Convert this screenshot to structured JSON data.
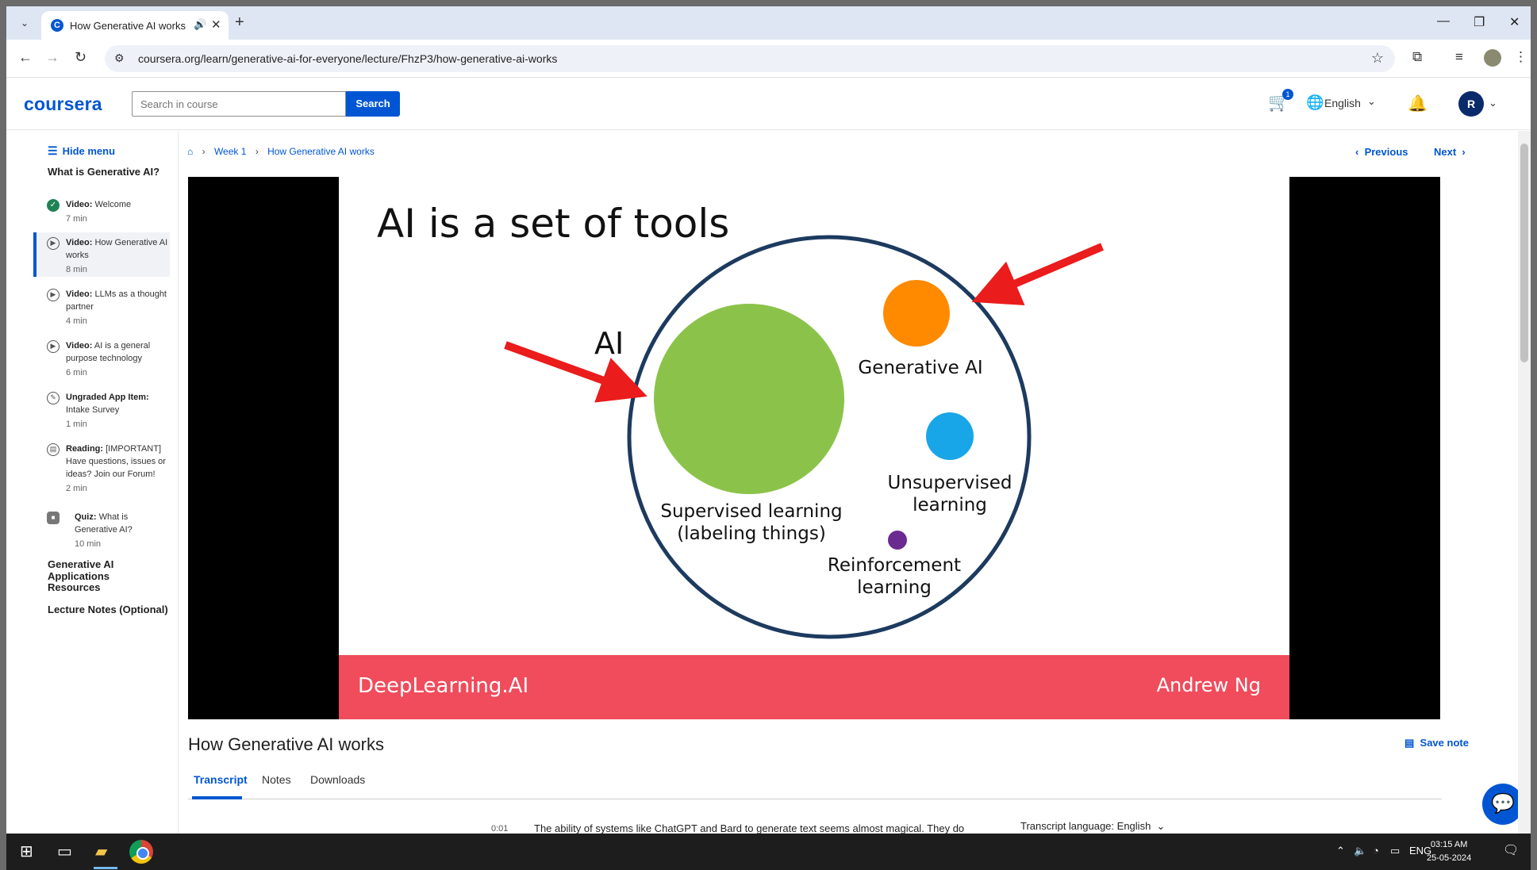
{
  "browser": {
    "tab_title": "How Generative AI works |",
    "url": "coursera.org/learn/generative-ai-for-everyone/lecture/FhzP3/how-generative-ai-works"
  },
  "header": {
    "logo": "coursera",
    "search_placeholder": "Search in course",
    "search_button": "Search",
    "cart_count": "1",
    "language": "English",
    "user_initial": "R"
  },
  "sidebar": {
    "hide_menu": "Hide menu",
    "section_title": "What is Generative AI?",
    "items": [
      {
        "type": "Video:",
        "title": "Welcome",
        "duration": "7 min",
        "status": "completed"
      },
      {
        "type": "Video:",
        "title": "How Generative AI works",
        "duration": "8 min",
        "status": "active"
      },
      {
        "type": "Video:",
        "title": "LLMs as a thought partner",
        "duration": "4 min",
        "status": "pending"
      },
      {
        "type": "Video:",
        "title": "AI is a general purpose technology",
        "duration": "6 min",
        "status": "pending"
      },
      {
        "type": "Ungraded App Item:",
        "title": "Intake Survey",
        "duration": "1 min",
        "status": "pending"
      },
      {
        "type": "Reading:",
        "title": "[IMPORTANT] Have questions, issues or ideas? Join our Forum!",
        "duration": "2 min",
        "status": "pending"
      },
      {
        "type": "Quiz:",
        "title": "What is Generative AI?",
        "duration": "10 min",
        "status": "locked"
      }
    ],
    "modules": [
      "Generative AI Applications",
      "Resources",
      "Lecture Notes (Optional)"
    ]
  },
  "breadcrumb": {
    "week": "Week 1",
    "lecture": "How Generative AI works"
  },
  "pager": {
    "previous": "Previous",
    "next": "Next"
  },
  "slide": {
    "title": "AI is a set of tools",
    "label_ai": "AI",
    "label_generative": "Generative AI",
    "label_unsupervised_1": "Unsupervised",
    "label_unsupervised_2": "learning",
    "label_supervised_1": "Supervised learning",
    "label_supervised_2": "(labeling things)",
    "label_reinforcement_1": "Reinforcement",
    "label_reinforcement_2": "learning",
    "brand": "DeepLearning.AI",
    "author": "Andrew Ng",
    "colors": {
      "outer_circle": "#1d3a5f",
      "supervised": "#8bc34a",
      "generative": "#ff8a00",
      "unsupervised": "#18a6e8",
      "reinforcement": "#6b2a8f",
      "arrow": "#ea1c1c",
      "footer": "#f04c5c"
    }
  },
  "lecture": {
    "title": "How Generative AI works",
    "save_note": "Save note",
    "tabs": [
      "Transcript",
      "Notes",
      "Downloads"
    ],
    "active_tab": "Transcript",
    "transcript_time": "0:01",
    "transcript_text": "The ability of systems like ChatGPT and Bard to generate text seems almost magical. They do",
    "transcript_lang_label": "Transcript language:",
    "transcript_lang_value": "English"
  },
  "taskbar": {
    "lang": "ENG",
    "time": "03:15 AM",
    "date": "25-05-2024"
  }
}
